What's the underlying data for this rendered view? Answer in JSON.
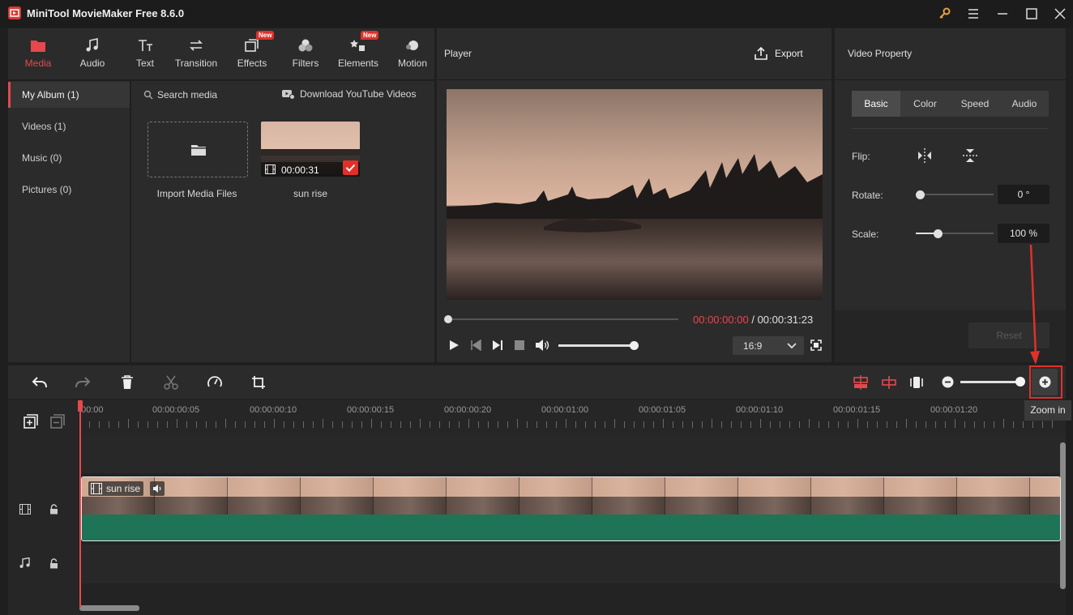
{
  "app": {
    "title": "MiniTool MovieMaker Free 8.6.0"
  },
  "colors": {
    "accent": "#e5484d",
    "clip_green": "#1f7457",
    "annotation_red": "#e0302a"
  },
  "media_toolbar": {
    "items": [
      {
        "label": "Media",
        "icon": "folder-icon",
        "active": true
      },
      {
        "label": "Audio",
        "icon": "music-note-icon"
      },
      {
        "label": "Text",
        "icon": "text-icon"
      },
      {
        "label": "Transition",
        "icon": "transition-icon"
      },
      {
        "label": "Effects",
        "icon": "effects-icon",
        "badge": "New"
      },
      {
        "label": "Filters",
        "icon": "filters-icon"
      },
      {
        "label": "Elements",
        "icon": "elements-icon",
        "badge": "New"
      },
      {
        "label": "Motion",
        "icon": "motion-icon"
      }
    ]
  },
  "sidebar": {
    "items": [
      {
        "label": "My Album (1)",
        "active": true
      },
      {
        "label": "Videos (1)"
      },
      {
        "label": "Music (0)"
      },
      {
        "label": "Pictures (0)"
      }
    ]
  },
  "media": {
    "search_label": "Search media",
    "download_label": "Download YouTube Videos",
    "import_label": "Import Media Files",
    "clip_name": "sun rise",
    "clip_duration": "00:00:31"
  },
  "player": {
    "title": "Player",
    "export_label": "Export",
    "current_time": "00:00:00:00",
    "separator": "/",
    "total_time": "00:00:31:23",
    "aspect_ratio": "16:9"
  },
  "property": {
    "title": "Video Property",
    "tabs": [
      "Basic",
      "Color",
      "Speed",
      "Audio"
    ],
    "active_tab": "Basic",
    "flip_label": "Flip:",
    "rotate_label": "Rotate:",
    "rotate_value": "0 °",
    "scale_label": "Scale:",
    "scale_value": "100 %",
    "reset_label": "Reset"
  },
  "timeline": {
    "ruler_labels": [
      "00:00",
      "00:00:00:05",
      "00:00:00:10",
      "00:00:00:15",
      "00:00:00:20",
      "00:00:01:00",
      "00:00:01:05",
      "00:00:01:10",
      "00:00:01:15",
      "00:00:01:20"
    ],
    "clip_label": "sun rise",
    "tooltip": "Zoom in"
  }
}
